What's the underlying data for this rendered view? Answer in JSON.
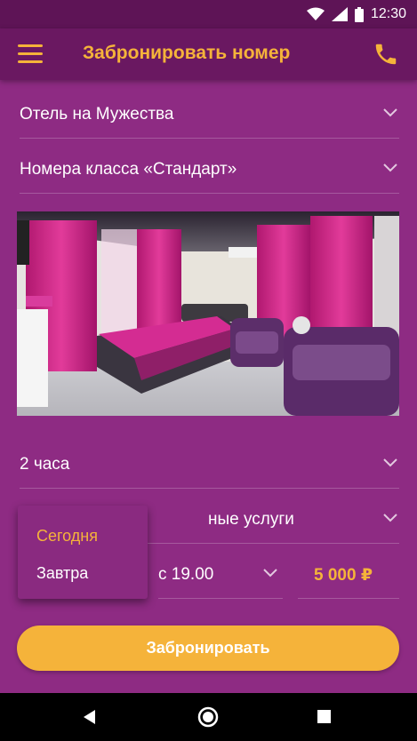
{
  "status_bar": {
    "time": "12:30",
    "icons": [
      "wifi-icon",
      "signal-icon",
      "battery-icon"
    ]
  },
  "app_bar": {
    "title": "Забронировать номер",
    "menu_icon": "hamburger-menu-icon",
    "call_icon": "phone-icon"
  },
  "form": {
    "hotel": "Отель на Мужества",
    "room_class": "Номера класса «Стандарт»",
    "duration": "2 часа",
    "extra_services": "ные услуги",
    "time_from": "с 19.00",
    "price": "5 000 ₽"
  },
  "day_dropdown": {
    "options": [
      "Сегодня",
      "Завтра"
    ],
    "selected": "Сегодня"
  },
  "actions": {
    "book_label": "Забронировать"
  },
  "colors": {
    "accent": "#f5b33a",
    "app_bar": "#6a1861",
    "background": "#8e2b83"
  }
}
